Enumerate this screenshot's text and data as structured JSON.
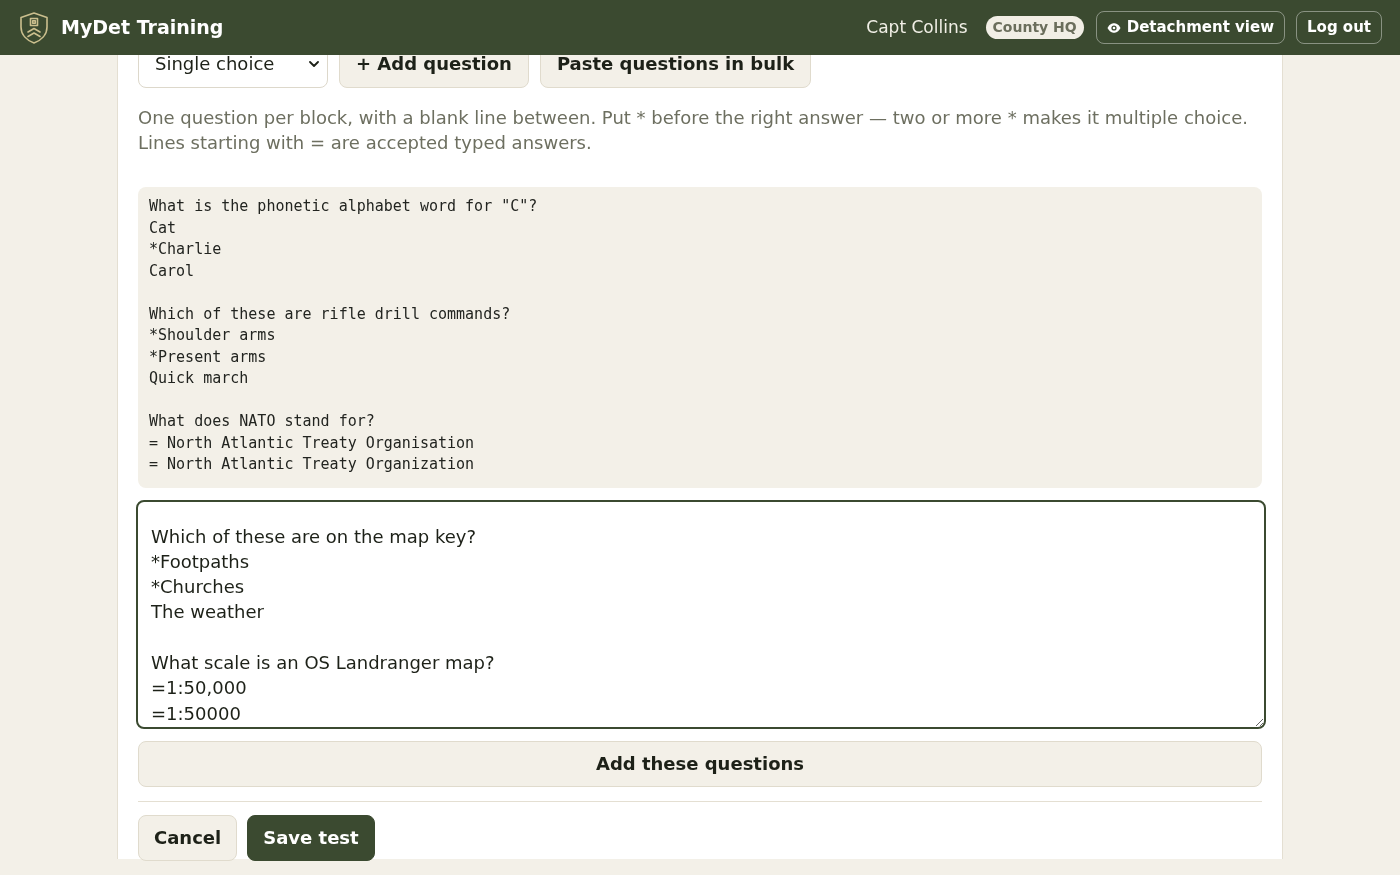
{
  "header": {
    "app_name": "MyDet Training",
    "user_name": "Capt Collins",
    "unit_badge": "County HQ",
    "buttons": [
      {
        "label": "Detachment view",
        "kind": "view"
      },
      {
        "label": "Log out",
        "kind": "plain"
      }
    ]
  },
  "toolbar": {
    "question_type": {
      "value": "Single choice"
    },
    "buttons": [
      "+ Add question",
      "Paste questions in bulk"
    ]
  },
  "bulk_paste": {
    "help_text": "One question per block, with a blank line between. Put * before the right answer — two or more * makes it multiple choice. Lines starting with = are accepted typed answers.",
    "example": [
      {
        "lines": [
          "What is the phonetic alphabet word for \"C\"?",
          "Cat",
          "*Charlie",
          "Carol"
        ]
      },
      {
        "lines": [
          "Which of these are rifle drill commands?",
          "*Shoulder arms",
          "*Present arms",
          "Quick march"
        ]
      },
      {
        "lines": [
          "What does NATO stand for?",
          "= North Atlantic Treaty Organisation",
          "= North Atlantic Treaty Organization"
        ]
      }
    ],
    "textarea": {
      "focused": true,
      "blocks": [
        {
          "lines": [
            "Which of these are on the map key?",
            "*Footpaths",
            "*Churches",
            "The weather"
          ]
        },
        {
          "lines": [
            "What scale is an OS Landranger map?",
            "=1:50,000",
            "=1:50000"
          ]
        }
      ]
    },
    "submit_button": "Add these questions"
  },
  "footer_buttons": [
    {
      "label": "Cancel",
      "kind": "secondary"
    },
    {
      "label": "Save test",
      "kind": "primary"
    }
  ]
}
